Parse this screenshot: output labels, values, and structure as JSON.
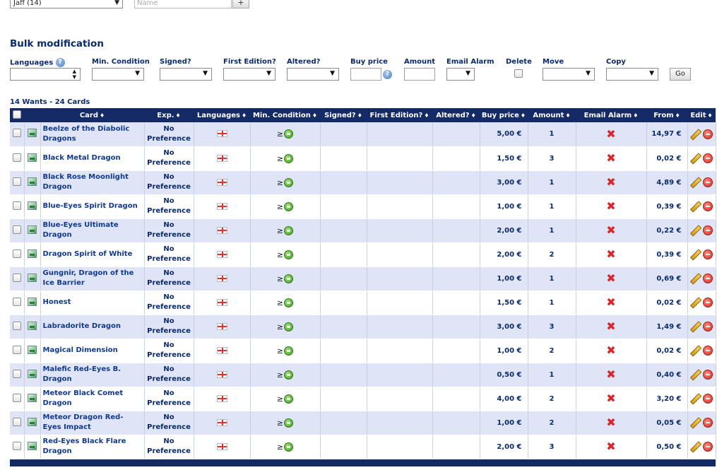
{
  "top": {
    "player_select_value": "Jaff (14)",
    "name_placeholder": "Name",
    "add_button": "+"
  },
  "bulk": {
    "title": "Bulk modification",
    "labels": {
      "languages": "Languages",
      "min_condition": "Min. Condition",
      "signed": "Signed?",
      "first_edition": "First Edition?",
      "altered": "Altered?",
      "buy_price": "Buy price",
      "amount": "Amount",
      "email_alarm": "Email Alarm",
      "delete": "Delete",
      "move": "Move",
      "copy": "Copy"
    },
    "go_button": "Go"
  },
  "summary": "14 Wants - 24 Cards",
  "headers": {
    "card": "Card",
    "exp": "Exp.",
    "languages": "Languages",
    "min_condition": "Min. Condition",
    "signed": "Signed?",
    "first_edition": "First Edition?",
    "altered": "Altered?",
    "buy_price": "Buy price",
    "amount": "Amount",
    "email_alarm": "Email Alarm",
    "from": "From",
    "edit": "Edit",
    "sort_glyph": "♦"
  },
  "condition_prefix": "≥",
  "rows": [
    {
      "card": "Beelze of the Diabolic Dragons",
      "exp": "No Preference",
      "buy_price": "5,00 €",
      "amount": "1",
      "from": "14,97 €"
    },
    {
      "card": "Black Metal Dragon",
      "exp": "No Preference",
      "buy_price": "1,50 €",
      "amount": "3",
      "from": "0,02 €"
    },
    {
      "card": "Black Rose Moonlight Dragon",
      "exp": "No Preference",
      "buy_price": "3,00 €",
      "amount": "1",
      "from": "4,89 €"
    },
    {
      "card": "Blue-Eyes Spirit Dragon",
      "exp": "No Preference",
      "buy_price": "1,00 €",
      "amount": "1",
      "from": "0,39 €"
    },
    {
      "card": "Blue-Eyes Ultimate Dragon",
      "exp": "No Preference",
      "buy_price": "2,00 €",
      "amount": "1",
      "from": "0,22 €"
    },
    {
      "card": "Dragon Spirit of White",
      "exp": "No Preference",
      "buy_price": "2,00 €",
      "amount": "2",
      "from": "0,39 €"
    },
    {
      "card": "Gungnir, Dragon of the Ice Barrier",
      "exp": "No Preference",
      "buy_price": "1,00 €",
      "amount": "1",
      "from": "0,69 €"
    },
    {
      "card": "Honest",
      "exp": "No Preference",
      "buy_price": "1,50 €",
      "amount": "1",
      "from": "0,02 €"
    },
    {
      "card": "Labradorite Dragon",
      "exp": "No Preference",
      "buy_price": "3,00 €",
      "amount": "3",
      "from": "1,49 €"
    },
    {
      "card": "Magical Dimension",
      "exp": "No Preference",
      "buy_price": "1,00 €",
      "amount": "2",
      "from": "0,02 €"
    },
    {
      "card": "Malefic Red-Eyes B. Dragon",
      "exp": "No Preference",
      "buy_price": "0,50 €",
      "amount": "1",
      "from": "0,40 €"
    },
    {
      "card": "Meteor Black Comet Dragon",
      "exp": "No Preference",
      "buy_price": "4,00 €",
      "amount": "2",
      "from": "3,20 €"
    },
    {
      "card": "Meteor Dragon Red-Eyes Impact",
      "exp": "No Preference",
      "buy_price": "1,00 €",
      "amount": "2",
      "from": "0,05 €"
    },
    {
      "card": "Red-Eyes Black Flare Dragon",
      "exp": "No Preference",
      "buy_price": "2,00 €",
      "amount": "3",
      "from": "0,50 €"
    }
  ],
  "icons": {
    "row_checkbox": "checkbox-icon",
    "thumbnail": "card-image-icon",
    "language": "uk-flag-icon",
    "condition": "condition-green-icon",
    "email_alarm": "red-x-icon",
    "edit": "pencil-icon",
    "delete": "minus-circle-icon",
    "help": "question-icon"
  },
  "colors": {
    "header_bg": "#142a64",
    "row_odd": "#dfe5f6",
    "row_even": "#ffffff",
    "text": "#0a2a6b",
    "alarm_x": "#d8262b"
  }
}
